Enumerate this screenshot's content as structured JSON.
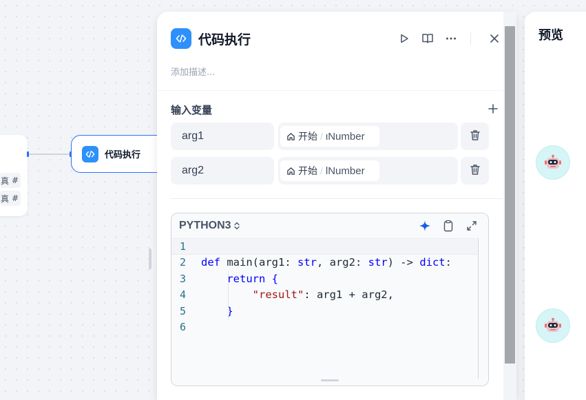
{
  "canvas": {
    "start_node": {
      "rows": [
        {
          "text": "真",
          "type_icon": "#"
        },
        {
          "text": "真",
          "type_icon": "#"
        }
      ]
    },
    "code_node": {
      "label": "代码执行",
      "icon": "code-icon"
    }
  },
  "panel": {
    "title": "代码执行",
    "description_placeholder": "添加描述...",
    "actions": [
      "run-icon",
      "book-icon",
      "more-icon",
      "close-icon"
    ],
    "input_section": {
      "title": "输入变量",
      "add_icon": "plus-icon",
      "variables": [
        {
          "name": "arg1",
          "source_node": "开始",
          "separator": "/",
          "source_var": "ιNumber",
          "delete_icon": "trash-icon"
        },
        {
          "name": "arg2",
          "source_node": "开始",
          "separator": "/",
          "source_var": "lNumber",
          "delete_icon": "trash-icon"
        }
      ]
    },
    "code_editor": {
      "language": "PYTHON3",
      "actions": [
        "sparkle-icon",
        "clipboard-icon",
        "expand-icon"
      ],
      "lines": [
        {
          "num": "1",
          "code": ""
        },
        {
          "num": "2",
          "code": "def main(arg1: str, arg2: str) -> dict:"
        },
        {
          "num": "3",
          "code": "    return {"
        },
        {
          "num": "4",
          "code": "        \"result\": arg1 + arg2,"
        },
        {
          "num": "5",
          "code": "    }"
        },
        {
          "num": "6",
          "code": ""
        }
      ]
    }
  },
  "preview": {
    "title": "预览",
    "avatars": [
      "robot-avatar",
      "robot-avatar"
    ]
  },
  "colors": {
    "accent": "#2970ff",
    "icon_bg": "#2e90fa",
    "keyword": "#0000ff",
    "string": "#a31515"
  }
}
